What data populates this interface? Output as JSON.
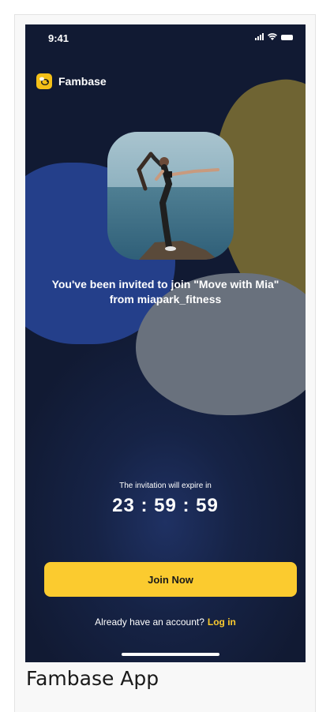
{
  "status_bar": {
    "time": "9:41",
    "icons": [
      "signal-icon",
      "wifi-icon",
      "battery-icon"
    ]
  },
  "app": {
    "name": "Fambase",
    "logo_icon": "bee-icon",
    "brand_color": "#fbcb2f"
  },
  "invitation": {
    "photo_description_icon": "profile-photo",
    "text": "You've been invited to join \"Move with Mia\" from miapark_fitness",
    "expire_label": "The invitation will expire in",
    "countdown": "23 : 59 : 59"
  },
  "actions": {
    "join_label": "Join Now",
    "account_prompt": "Already have an account?",
    "login_label": "Log in"
  },
  "caption": "Fambase App",
  "colors": {
    "background": "#111a33",
    "accent": "#fbcb2f",
    "blob_blue": "#243f8a",
    "blob_olive": "#6f6433",
    "blob_grey": "#69717d"
  }
}
